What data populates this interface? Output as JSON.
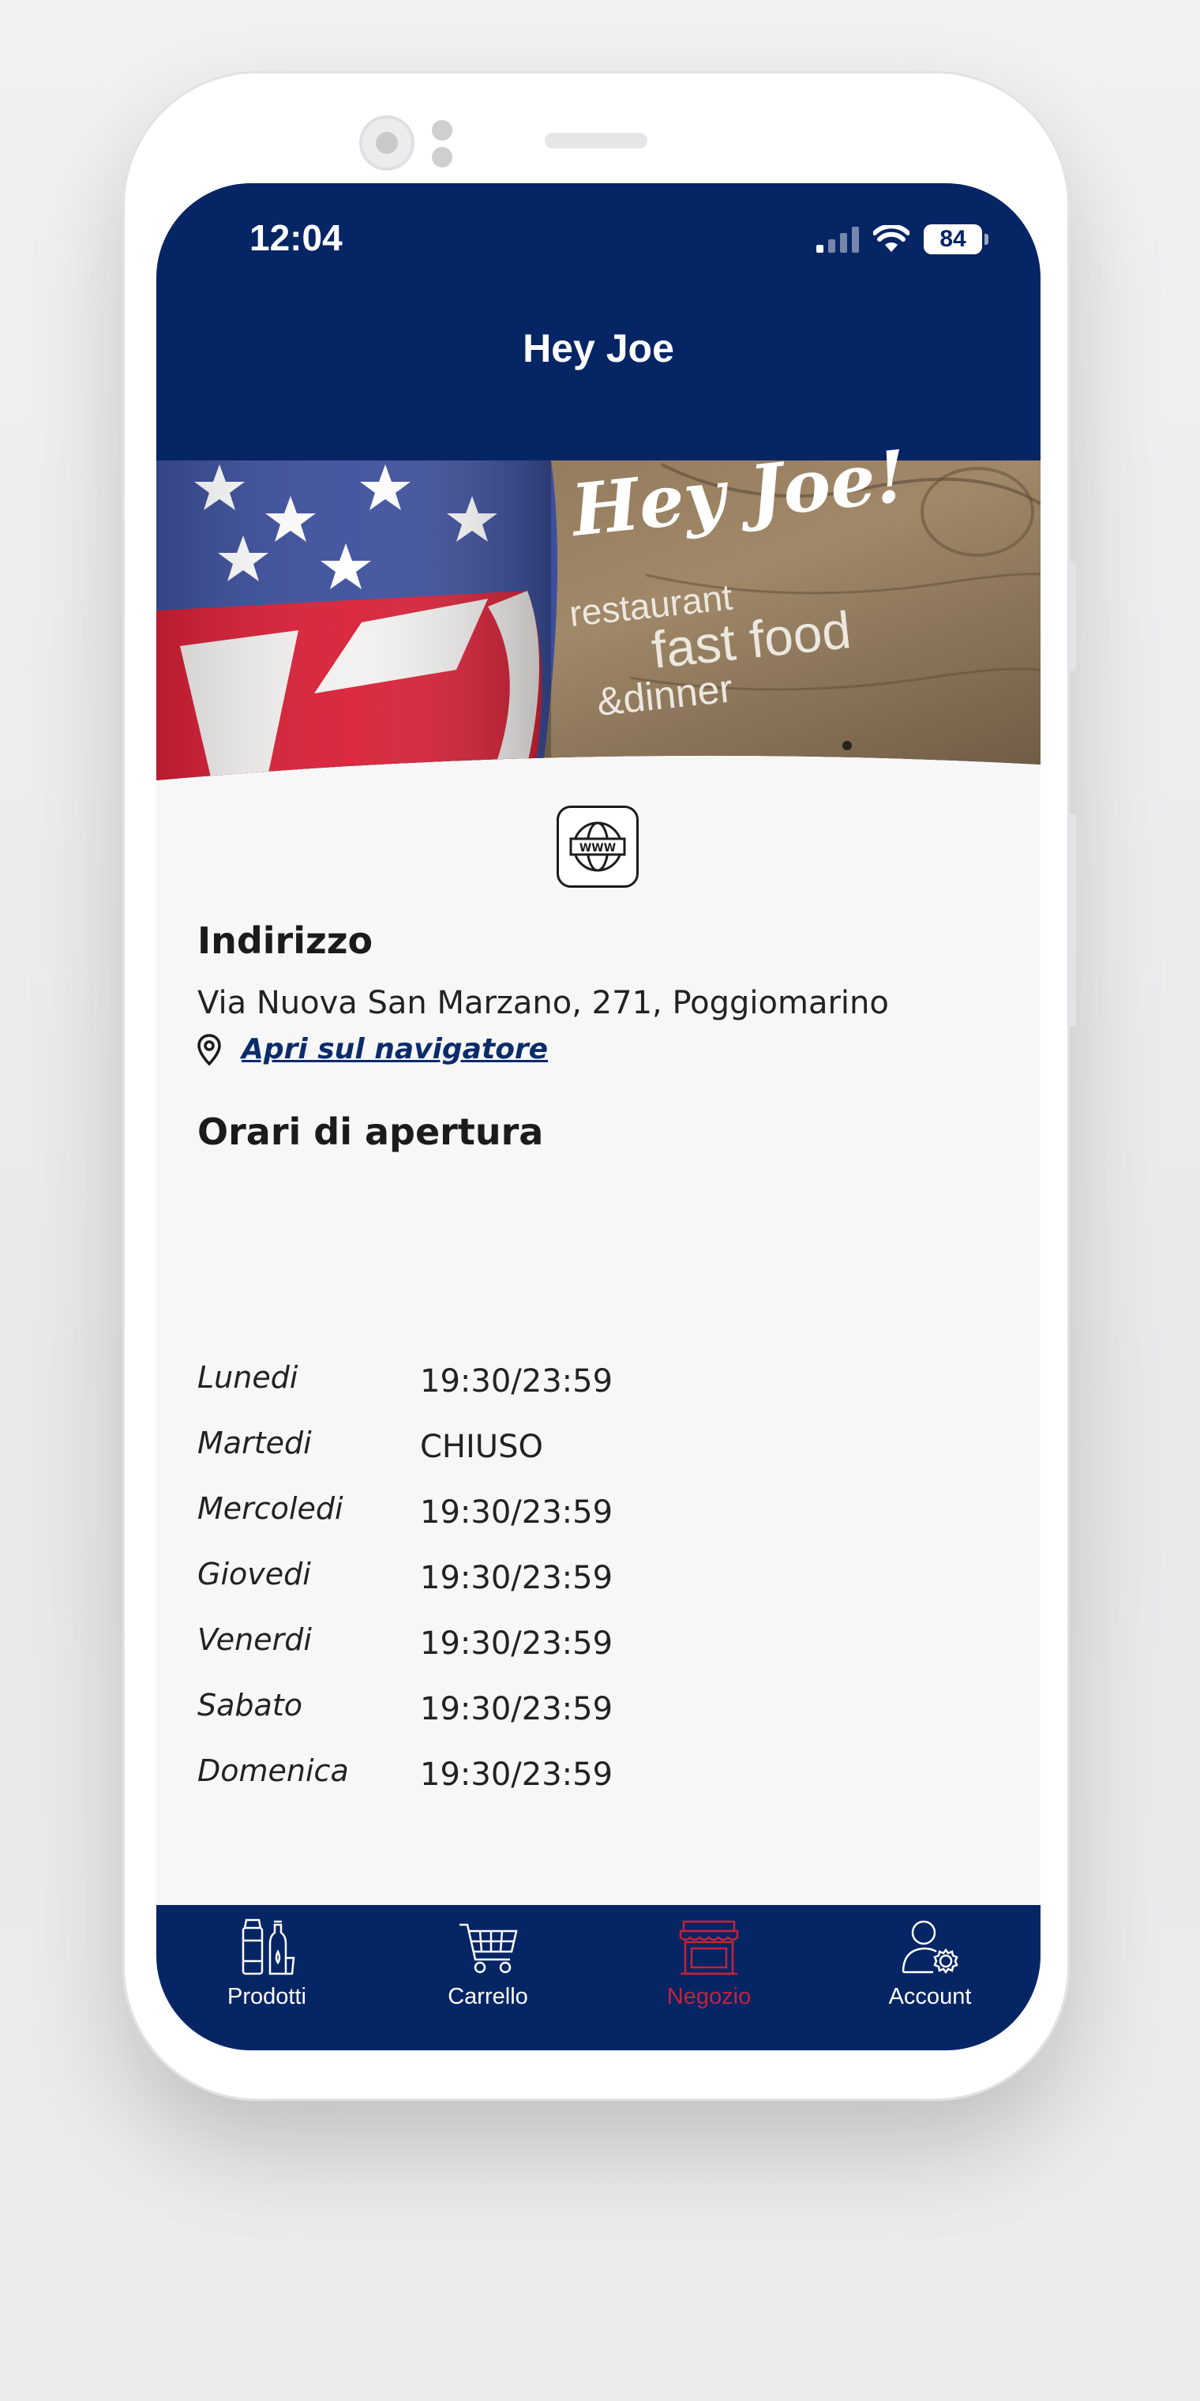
{
  "status_bar": {
    "time": "12:04",
    "battery": "84"
  },
  "header": {
    "title": "Hey Joe"
  },
  "banner": {
    "line1": "Hey Joe!",
    "line2": "restaurant",
    "line3": "fast food",
    "line4": "&dinner"
  },
  "store": {
    "website_icon_label": "WWW",
    "address_title": "Indirizzo",
    "address": "Via Nuova San Marzano, 271, Poggiomarino",
    "navigator_link": "Apri sul navigatore",
    "hours_title": "Orari di apertura",
    "hours": [
      {
        "day": "Lunedi",
        "time": "19:30/23:59"
      },
      {
        "day": "Martedi",
        "time": "CHIUSO"
      },
      {
        "day": "Mercoledi",
        "time": "19:30/23:59"
      },
      {
        "day": "Giovedi",
        "time": "19:30/23:59"
      },
      {
        "day": "Venerdi",
        "time": "19:30/23:59"
      },
      {
        "day": "Sabato",
        "time": "19:30/23:59"
      },
      {
        "day": "Domenica",
        "time": "19:30/23:59"
      }
    ]
  },
  "tabs": [
    {
      "label": "Prodotti",
      "icon": "products-icon",
      "active": false
    },
    {
      "label": "Carrello",
      "icon": "cart-icon",
      "active": false
    },
    {
      "label": "Negozio",
      "icon": "store-icon",
      "active": true
    },
    {
      "label": "Account",
      "icon": "account-settings-icon",
      "active": false
    }
  ],
  "colors": {
    "primary": "#062565",
    "active_tab": "#c4223b",
    "background": "#f8f7f8",
    "text": "#1b1b1b"
  }
}
